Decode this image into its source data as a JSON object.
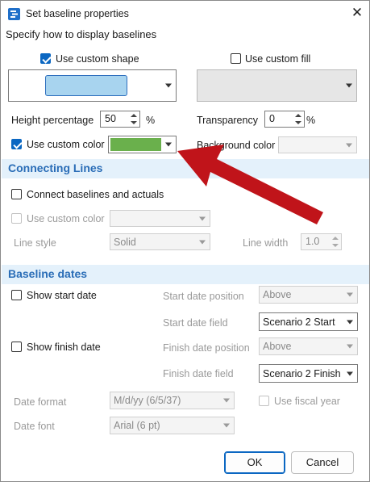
{
  "window": {
    "title": "Set baseline properties",
    "close_glyph": "✕"
  },
  "intro": "Specify how to display baselines",
  "shape": {
    "use_custom_shape_label": "Use custom shape",
    "use_custom_shape_checked": true,
    "shape_swatch_color": "#a8d4ef"
  },
  "fill": {
    "use_custom_fill_label": "Use custom fill",
    "use_custom_fill_checked": false
  },
  "height": {
    "label": "Height percentage",
    "value": "50",
    "unit": "%"
  },
  "transparency": {
    "label": "Transparency",
    "value": "0",
    "unit": "%"
  },
  "color": {
    "use_custom_color_label": "Use custom color",
    "use_custom_color_checked": true,
    "swatch_color": "#6ab04c",
    "background_color_label": "Background color"
  },
  "connecting_lines": {
    "heading": "Connecting Lines",
    "connect_label": "Connect baselines and actuals",
    "connect_checked": false,
    "use_custom_color_label": "Use custom color",
    "line_style_label": "Line style",
    "line_style_value": "Solid",
    "line_width_label": "Line width",
    "line_width_value": "1.0"
  },
  "baseline_dates": {
    "heading": "Baseline dates",
    "show_start_label": "Show start date",
    "show_finish_label": "Show finish date",
    "start_position_label": "Start date position",
    "start_position_value": "Above",
    "start_field_label": "Start date field",
    "start_field_value": "Scenario 2 Start",
    "finish_position_label": "Finish date position",
    "finish_position_value": "Above",
    "finish_field_label": "Finish date field",
    "finish_field_value": "Scenario 2 Finish",
    "date_format_label": "Date format",
    "date_format_value": "M/d/yy (6/5/37)",
    "fiscal_year_label": "Use fiscal year",
    "date_font_label": "Date font",
    "date_font_value": "Arial (6 pt)"
  },
  "buttons": {
    "ok": "OK",
    "cancel": "Cancel"
  },
  "colors": {
    "accent": "#0b67c2",
    "section_bg": "#e4f1fb",
    "heading": "#2a6db7",
    "arrow": "#c0141a"
  }
}
